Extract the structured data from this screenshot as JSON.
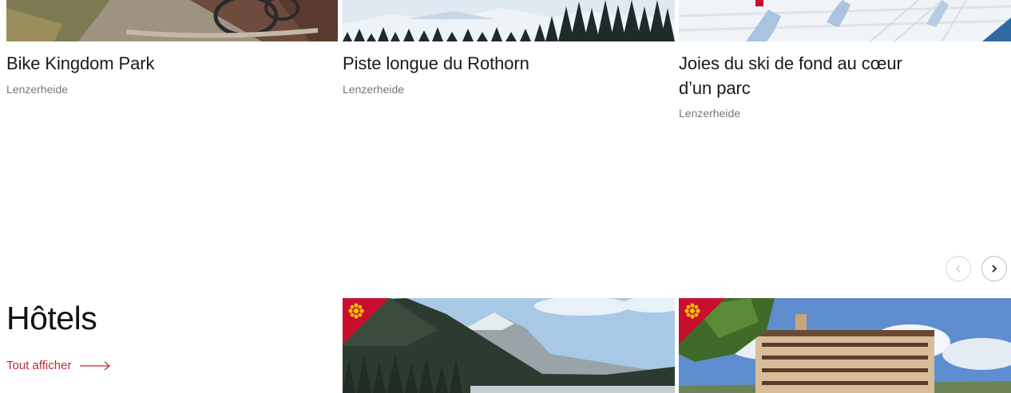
{
  "experiences": [
    {
      "title": "Bike Kingdom Park",
      "location": "Lenzerheide",
      "image_icon": "mountain-bike-photo"
    },
    {
      "title": "Piste longue du Rothorn",
      "location": "Lenzerheide",
      "image_icon": "snowy-forest-photo"
    },
    {
      "title": "Joies du ski de fond au cœur",
      "title_line2": "d’un parc",
      "location": "Lenzerheide",
      "image_icon": "cross-country-ski-photo"
    }
  ],
  "carousel": {
    "prev_icon": "chevron-left-icon",
    "next_icon": "chevron-right-icon"
  },
  "hotels": {
    "heading": "Hôtels",
    "view_all_label": "Tout afficher",
    "view_all_icon": "arrow-right-icon",
    "cards": [
      {
        "image_icon": "mountain-valley-photo",
        "badge_icon": "edelweiss-badge-icon"
      },
      {
        "image_icon": "hotel-building-photo",
        "badge_icon": "edelweiss-badge-icon"
      }
    ]
  },
  "colors": {
    "accent": "#c22b36",
    "badge_red": "#c8102e",
    "muted_text": "#777777"
  }
}
